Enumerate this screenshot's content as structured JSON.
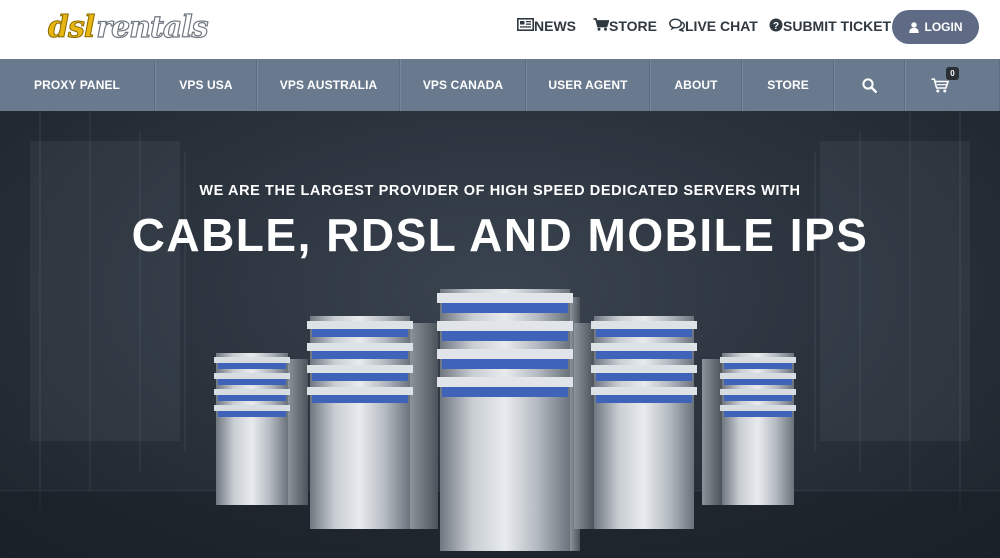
{
  "logo": {
    "part1": "dsl",
    "part2": "rentals"
  },
  "toplinks": [
    {
      "label": "NEWS",
      "icon": "newspaper-icon"
    },
    {
      "label": "STORE",
      "icon": "cart-icon"
    },
    {
      "label": "LIVE CHAT",
      "icon": "chat-icon"
    },
    {
      "label": "SUBMIT TICKET",
      "icon": "question-circle-icon"
    }
  ],
  "login": {
    "label": "LOGIN",
    "icon": "user-icon"
  },
  "nav": {
    "items": [
      "PROXY PANEL",
      "VPS USA",
      "VPS AUSTRALIA",
      "VPS CANADA",
      "USER AGENT",
      "ABOUT",
      "STORE"
    ],
    "search_icon": "search-icon",
    "cart_icon": "cart-icon",
    "cart_count": "0"
  },
  "hero": {
    "subtitle": "WE ARE THE LARGEST PROVIDER OF HIGH SPEED DEDICATED SERVERS WITH",
    "title": "CABLE, RDSL AND MOBILE IPS"
  },
  "colors": {
    "nav_bg": "#6a7a8e",
    "login_bg": "#5f6b84",
    "logo_yellow": "#e8b612",
    "server_blue": "#3f63b8",
    "hero_bg": "#2a323c"
  }
}
